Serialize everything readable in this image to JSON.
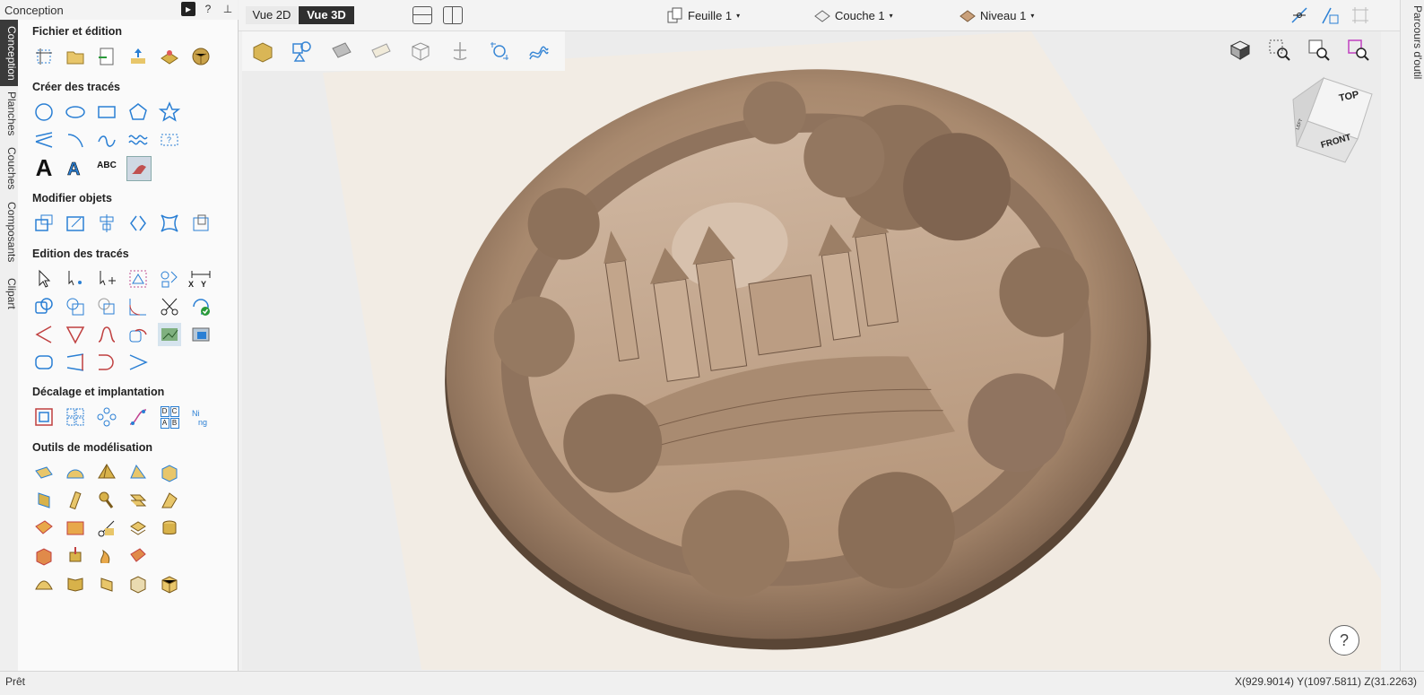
{
  "panel": {
    "title": "Conception",
    "vertical_tabs": [
      "Conception",
      "Planches",
      "Couches",
      "Composants",
      "Clipart"
    ],
    "sections": [
      "Fichier et édition",
      "Créer des tracés",
      "Modifier objets",
      "Edition des tracés",
      "Décalage et implantation",
      "Outils de modélisation"
    ],
    "xy_label_x": "X",
    "xy_label_y": "Y",
    "text_big": "A",
    "text_abc": "ABC",
    "grid_label": "D C\nA B"
  },
  "topbar": {
    "vue2d": "Vue 2D",
    "vue3d": "Vue 3D",
    "feuille": "Feuille 1",
    "couche": "Couche 1",
    "niveau": "Niveau 1"
  },
  "viewcube": {
    "top": "TOP",
    "front": "FRONT",
    "left": "LEFT"
  },
  "right_tab": "Parcours d'outil",
  "status": {
    "left": "Prêt",
    "coords": "X(929.9014) Y(1097.5811) Z(31.2263)"
  },
  "help": "?",
  "colors": {
    "accent_blue": "#2a7fd4",
    "accent_gold": "#d8b24a",
    "relief": "#a8896e",
    "active_tab": "#3a3a3a"
  }
}
